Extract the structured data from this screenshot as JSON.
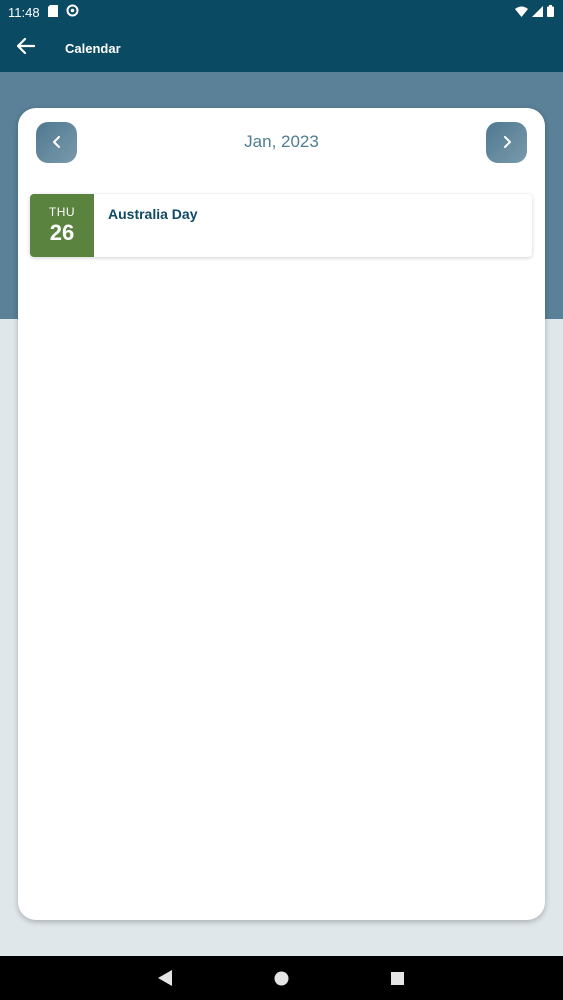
{
  "status_bar": {
    "time": "11:48",
    "left_icons": [
      "sd-card-icon",
      "sync-icon"
    ],
    "right_icons": [
      "wifi-icon",
      "signal-icon",
      "battery-icon"
    ]
  },
  "app_bar": {
    "title": "Calendar",
    "back_icon": "arrow-left-icon"
  },
  "calendar": {
    "month_label": "Jan, 2023",
    "prev_icon": "chevron-left-icon",
    "next_icon": "chevron-right-icon",
    "events": [
      {
        "dow": "THU",
        "day": "26",
        "title": "Australia Day"
      }
    ]
  },
  "nav_bar": {
    "buttons": [
      "back-triangle-icon",
      "home-circle-icon",
      "recents-square-icon"
    ]
  },
  "colors": {
    "app_bar": "#0a4a63",
    "hero": "#5a8197",
    "date_block": "#5a833f",
    "event_title": "#0d4a63",
    "month_label": "#4f7d92"
  }
}
